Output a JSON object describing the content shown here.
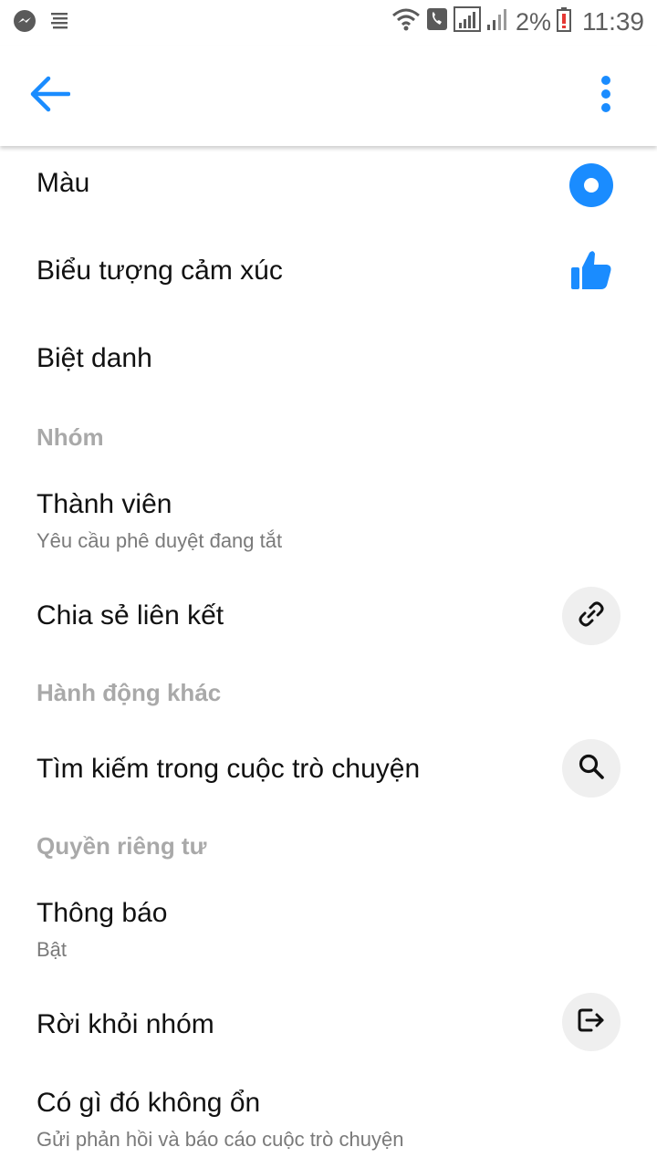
{
  "status_bar": {
    "battery_percent": "2%",
    "time": "11:39",
    "icons": [
      "messenger-icon",
      "notification-lines-icon",
      "wifi-icon",
      "call-icon",
      "signal-icon",
      "signal-icon-2",
      "battery-low-icon"
    ]
  },
  "app_bar": {
    "back_icon": "arrow-back-icon",
    "more_icon": "more-vert-icon"
  },
  "colors": {
    "accent": "#1a8cff",
    "icon_circle_bg": "#efefef",
    "section_header": "#a9a9a9",
    "subtitle": "#7a7a7a"
  },
  "settings": {
    "color": {
      "label": "Màu",
      "icon": "color-dot-icon"
    },
    "emoji": {
      "label": "Biểu tượng cảm xúc",
      "icon": "thumbs-up-icon"
    },
    "nickname": {
      "label": "Biệt danh"
    },
    "group_header": "Nhóm",
    "members": {
      "label": "Thành viên",
      "subtitle": "Yêu cầu phê duyệt đang tắt"
    },
    "share_link": {
      "label": "Chia sẻ liên kết",
      "icon": "link-icon"
    },
    "other_actions_header": "Hành động khác",
    "search": {
      "label": "Tìm kiếm trong cuộc trò chuyện",
      "icon": "search-icon"
    },
    "privacy_header": "Quyền riêng tư",
    "notifications": {
      "label": "Thông báo",
      "subtitle": "Bật"
    },
    "leave_group": {
      "label": "Rời khỏi nhóm",
      "icon": "leave-icon"
    },
    "something_wrong": {
      "label": "Có gì đó không ổn",
      "subtitle": "Gửi phản hồi và báo cáo cuộc trò chuyện"
    }
  }
}
